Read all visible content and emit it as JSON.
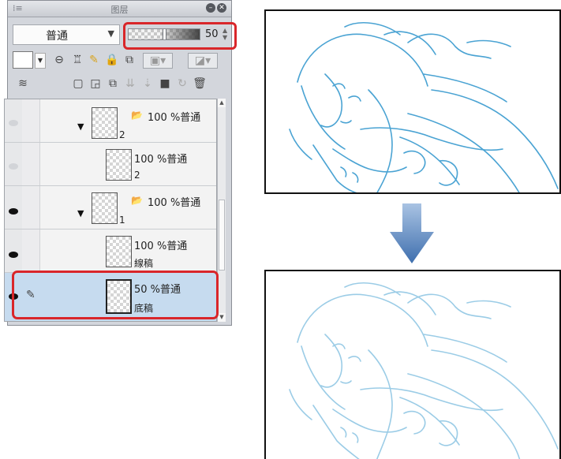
{
  "panel": {
    "title": "图层",
    "blend_mode": "普通",
    "opacity": "50",
    "opacity_fraction": 0.5
  },
  "layers": [
    {
      "mode": "100 %普通",
      "name": "2",
      "visible": false,
      "type": "folder"
    },
    {
      "mode": "100 %普通",
      "name": "2",
      "visible": false,
      "type": "layer"
    },
    {
      "mode": "100 %普通",
      "name": "1",
      "visible": true,
      "type": "folder"
    },
    {
      "mode": "100 %普通",
      "name": "線稿",
      "visible": true,
      "type": "layer"
    },
    {
      "mode": "50 %普通",
      "name": "底稿",
      "visible": true,
      "type": "layer",
      "selected": true
    }
  ],
  "colors": {
    "highlight": "#d9262a",
    "selected_row": "#c6dbef",
    "line_art": "#4aa3d3",
    "arrow": "#4f7db8"
  },
  "icons": [
    "menu-grip-icon",
    "minimize-icon",
    "close-icon",
    "color-swatch-icon",
    "mask-icon",
    "clip-icon",
    "reference-icon",
    "lock-icon",
    "lock-transparency-icon",
    "new-layer-icon",
    "new-folder-icon",
    "copy-layer-icon",
    "eye-icon",
    "pencil-icon",
    "folder-icon",
    "trash-icon"
  ]
}
